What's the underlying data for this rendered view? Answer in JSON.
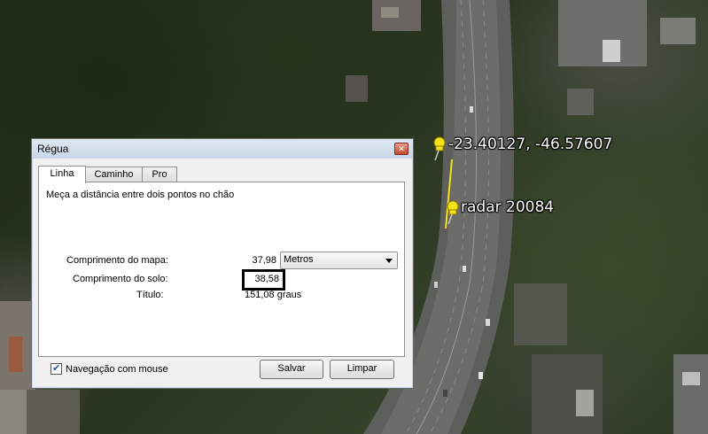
{
  "map": {
    "placemarks": [
      {
        "label": "-23.40127, -46.57607"
      },
      {
        "label": "radar 20084"
      }
    ],
    "pin_color": "#f5e21a"
  },
  "dialog": {
    "title": "Régua",
    "close_icon": "close-icon",
    "tabs": [
      {
        "label": "Linha",
        "active": true
      },
      {
        "label": "Caminho",
        "active": false
      },
      {
        "label": "Pro",
        "active": false
      }
    ],
    "description": "Meça a distância entre dois pontos no chão",
    "map_length": {
      "label": "Comprimento do mapa:",
      "value": "37,98"
    },
    "ground_length": {
      "label": "Comprimento do solo:",
      "value": "38,58"
    },
    "heading": {
      "label": "Título:",
      "value": "151,08 graus"
    },
    "units": {
      "selected": "Metros"
    },
    "mouse_nav": {
      "label": "Navegação com mouse",
      "checked": true
    },
    "buttons": {
      "save": "Salvar",
      "clear": "Limpar"
    }
  }
}
